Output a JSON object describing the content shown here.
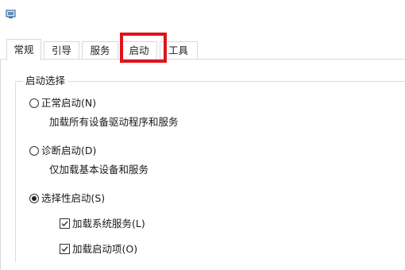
{
  "window": {
    "icon": "system-config-icon"
  },
  "tabs": [
    {
      "label": "常规",
      "active": true
    },
    {
      "label": "引导",
      "active": false
    },
    {
      "label": "服务",
      "active": false
    },
    {
      "label": "启动",
      "active": false,
      "highlighted": true
    },
    {
      "label": "工具",
      "active": false
    }
  ],
  "startup_selection": {
    "legend": "启动选择",
    "normal": {
      "label": "正常启动(N)",
      "description": "加载所有设备驱动程序和服务",
      "selected": false
    },
    "diagnostic": {
      "label": "诊断启动(D)",
      "description": "仅加载基本设备和服务",
      "selected": false
    },
    "selective": {
      "label": "选择性启动(S)",
      "selected": true,
      "options": [
        {
          "label": "加载系统服务(L)",
          "checked": true
        },
        {
          "label": "加载启动项(O)",
          "checked": true
        }
      ]
    }
  },
  "colors": {
    "highlight_border": "#e0121a",
    "border": "#d9d9d9"
  }
}
